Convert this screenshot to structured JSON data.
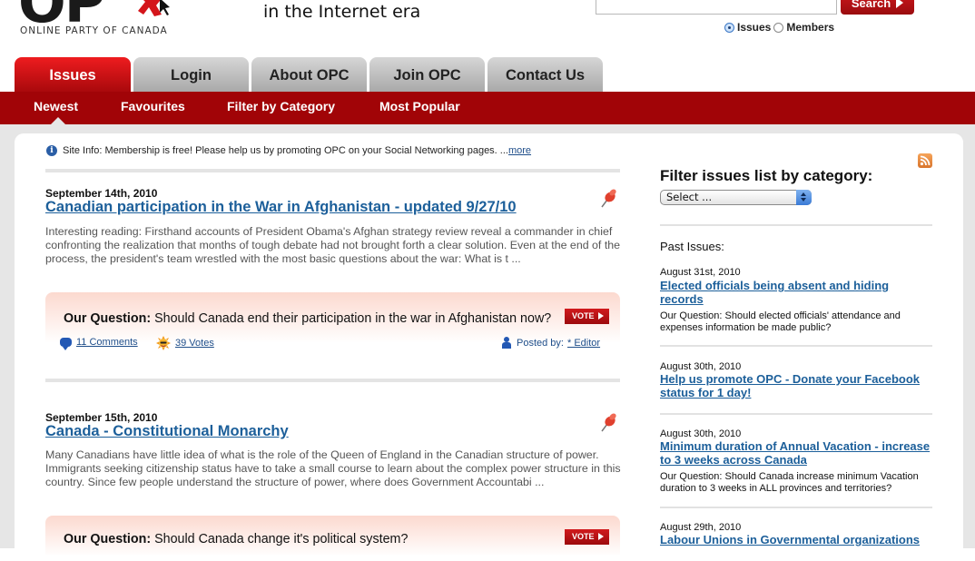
{
  "header": {
    "logo_letters": "OP",
    "logo_subtitle": "ONLINE PARTY OF CANADA",
    "tagline": "in the Internet era",
    "search": {
      "input_value": "",
      "button_label": "Search",
      "scope_options": [
        {
          "label": "Issues",
          "selected": true
        },
        {
          "label": "Members",
          "selected": false
        }
      ]
    }
  },
  "tabs": [
    {
      "label": "Issues",
      "active": true
    },
    {
      "label": "Login",
      "active": false
    },
    {
      "label": "About OPC",
      "active": false
    },
    {
      "label": "Join OPC",
      "active": false
    },
    {
      "label": "Contact Us",
      "active": false
    }
  ],
  "subnav": [
    {
      "label": "Newest",
      "active": true
    },
    {
      "label": "Favourites"
    },
    {
      "label": "Filter by Category"
    },
    {
      "label": "Most Popular"
    }
  ],
  "site_info": {
    "text": "Site Info: Membership is free! Please help us by promoting OPC on your Social Networking pages. ...",
    "more_label": "more"
  },
  "issues": [
    {
      "date": "September 14th, 2010",
      "title": "Canadian participation in the War in Afghanistan - updated 9/27/10",
      "body": "Interesting reading: Firsthand accounts of President Obama's Afghan strategy review reveal a commander in chief confronting the realization that months of tough debate had not brought forth a clear solution. Even at the end of the process, the president's team wrestled with the most basic questions about the war: What is t ...",
      "question_label": "Our Question:",
      "question": "Should Canada end their participation in the war in Afghanistan now?",
      "vote_label": "VOTE",
      "comments": "11 Comments",
      "votes": "39 Votes",
      "posted_by_label": "Posted by:",
      "posted_by": "* Editor"
    },
    {
      "date": "September 15th, 2010",
      "title": "Canada - Constitutional Monarchy",
      "body": "Many Canadians have little idea of what is the role of the Queen of England in the Canadian structure of power. Immigrants seeking citizenship status have to take a small course to learn about the complex power structure in this country. Since few people understand the structure of power, where does Government Accountabi ...",
      "question_label": "Our Question:",
      "question": "Should Canada change it's political system?",
      "vote_label": "VOTE"
    }
  ],
  "sidebar": {
    "filter_title": "Filter issues list by category:",
    "select_value": "Select ...",
    "past_label": "Past Issues:",
    "past_issues": [
      {
        "date": "August 31st, 2010",
        "title": "Elected officials being absent and hiding records",
        "question": "Our Question: Should elected officials' attendance and expenses information be made public?"
      },
      {
        "date": "August 30th, 2010",
        "title": "Help us promote OPC - Donate your Facebook status for 1 day!",
        "question": ""
      },
      {
        "date": "August 30th, 2010",
        "title": "Minimum duration of Annual Vacation - increase to 3 weeks across Canada",
        "question": "Our Question: Should Canada increase minimum Vacation duration to 3 weeks in ALL provinces and territories?"
      },
      {
        "date": "August 29th, 2010",
        "title": "Labour Unions in Governmental organizations",
        "question": ""
      }
    ]
  },
  "colors": {
    "brand_red": "#a10407",
    "link_blue": "#1c5f9a",
    "page_bg": "#e6e6e6"
  }
}
